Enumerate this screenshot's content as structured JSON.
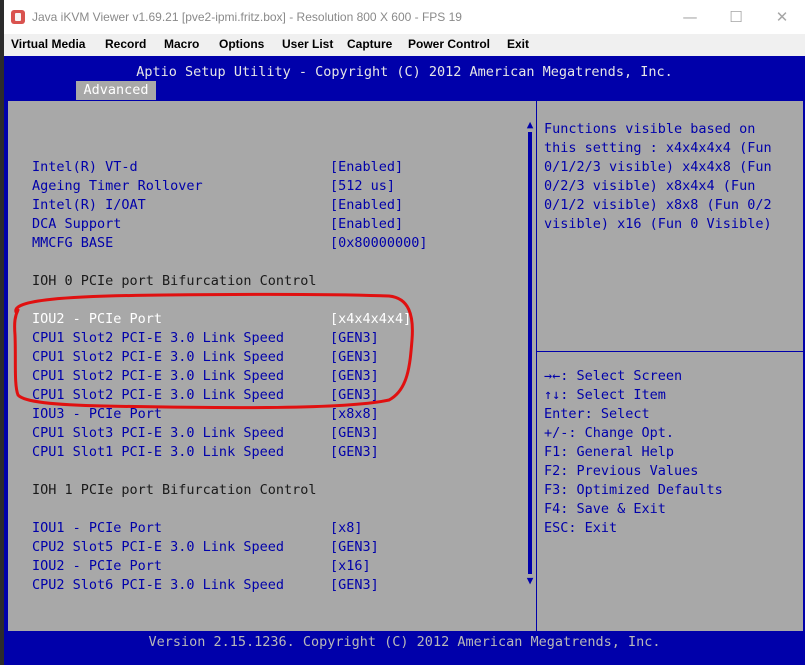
{
  "window": {
    "title": "Java iKVM Viewer v1.69.21 [pve2-ipmi.fritz.box]  - Resolution 800 X 600 - FPS 19",
    "minimize_glyph": "—",
    "maximize_glyph": "☐",
    "close_glyph": "✕"
  },
  "menu": {
    "items": [
      {
        "label": "Virtual Media"
      },
      {
        "label": "Record"
      },
      {
        "label": "Macro"
      },
      {
        "label": "Options"
      },
      {
        "label": "User List"
      },
      {
        "label": "Capture"
      },
      {
        "label": "Power Control"
      },
      {
        "label": "Exit"
      }
    ]
  },
  "bios": {
    "title": "Aptio Setup Utility - Copyright (C) 2012 American Megatrends, Inc.",
    "active_tab": "Advanced",
    "settings": [
      {
        "label": "Intel(R) VT-d",
        "value": "[Enabled]"
      },
      {
        "label": "Ageing Timer Rollover",
        "value": "[512 us]"
      },
      {
        "label": "Intel(R) I/OAT",
        "value": "[Enabled]"
      },
      {
        "label": "DCA Support",
        "value": "[Enabled]"
      },
      {
        "label": "MMCFG BASE",
        "value": "[0x80000000]"
      },
      {
        "label": "IOU2 - PCIe Port",
        "value": "[x4x4x4x4]"
      },
      {
        "label": "CPU1 Slot2 PCI-E 3.0 Link Speed",
        "value": "[GEN3]"
      },
      {
        "label": "CPU1 Slot2 PCI-E 3.0 Link Speed",
        "value": "[GEN3]"
      },
      {
        "label": "CPU1 Slot2 PCI-E 3.0 Link Speed",
        "value": "[GEN3]"
      },
      {
        "label": "CPU1 Slot2 PCI-E 3.0 Link Speed",
        "value": "[GEN3]"
      },
      {
        "label": "IOU3 - PCIe Port",
        "value": "[x8x8]"
      },
      {
        "label": "CPU1 Slot3 PCI-E 3.0 Link Speed",
        "value": "[GEN3]"
      },
      {
        "label": "CPU1 Slot1 PCI-E 3.0 Link Speed",
        "value": "[GEN3]"
      },
      {
        "label": "IOU1 - PCIe Port",
        "value": "[x8]"
      },
      {
        "label": "CPU2 Slot5 PCI-E 3.0 Link Speed",
        "value": "[GEN3]"
      },
      {
        "label": "IOU2 - PCIe Port",
        "value": "[x16]"
      },
      {
        "label": "CPU2 Slot6 PCI-E 3.0 Link Speed",
        "value": "[GEN3]"
      }
    ],
    "headings": [
      "IOH 0 PCIe port Bifurcation Control",
      "IOH 1 PCIe port Bifurcation Control"
    ],
    "help_lines": [
      "Functions visible based on",
      "this setting : x4x4x4x4 (Fun",
      "0/1/2/3 visible) x4x4x8 (Fun",
      "0/2/3 visible) x8x4x4 (Fun",
      "0/1/2 visible) x8x8 (Fun 0/2",
      "visible) x16 (Fun 0 Visible)"
    ],
    "key_help": [
      "→←: Select Screen",
      "↑↓: Select Item",
      "Enter: Select",
      "+/-: Change Opt.",
      "F1: General Help",
      "F2: Previous Values",
      "F3: Optimized Defaults",
      "F4: Save & Exit",
      "ESC: Exit"
    ],
    "scroll_up_glyph": "▲",
    "scroll_down_glyph": "▼",
    "footer": "Version 2.15.1236. Copyright (C) 2012 American Megatrends, Inc."
  },
  "colors": {
    "bios_blue": "#0000aa",
    "panel_gray": "#a8a8a8",
    "annotation_red": "#e01010"
  }
}
